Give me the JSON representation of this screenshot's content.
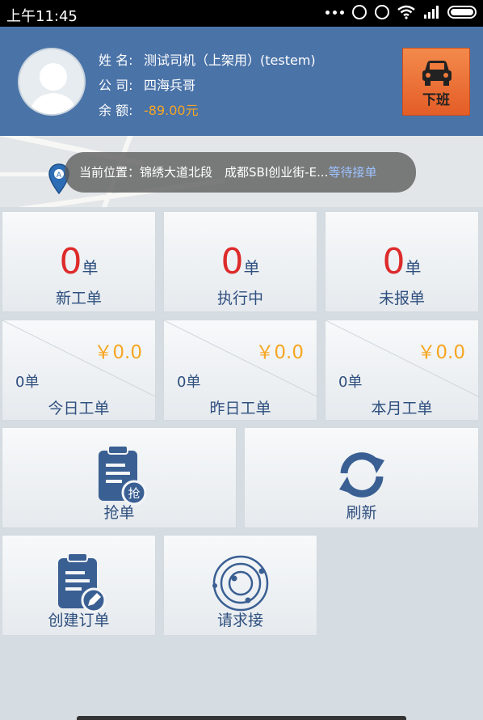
{
  "statusbar": {
    "time": "上午11:45"
  },
  "header": {
    "name_label": "姓 名:",
    "name_value": "测试司机（上架用）(testem)",
    "company_label": "公 司:",
    "company_value": "四海兵哥",
    "balance_label": "余 额:",
    "balance_value": "-89.00元",
    "off_label": "下班"
  },
  "location": {
    "text": "当前位置：锦绣大道北段　成都SBI创业街-E...",
    "wait": "等待接单"
  },
  "stats": [
    {
      "num": "0",
      "unit": "单",
      "label": "新工单"
    },
    {
      "num": "0",
      "unit": "单",
      "label": "执行中"
    },
    {
      "num": "0",
      "unit": "单",
      "label": "未报单"
    }
  ],
  "orders": [
    {
      "money": "￥0.0",
      "count": "0单",
      "label": "今日工单"
    },
    {
      "money": "￥0.0",
      "count": "0单",
      "label": "昨日工单"
    },
    {
      "money": "￥0.0",
      "count": "0单",
      "label": "本月工单"
    }
  ],
  "actions": {
    "grab": "抢单",
    "grab_badge": "抢",
    "refresh": "刷新",
    "create": "创建订单",
    "request": "请求接"
  },
  "colors": {
    "header": "#4a73a8",
    "accent_red": "#dd2b2b",
    "money": "#f6a623",
    "text_blue": "#2e4f7e",
    "off_button": "#e45d27"
  }
}
